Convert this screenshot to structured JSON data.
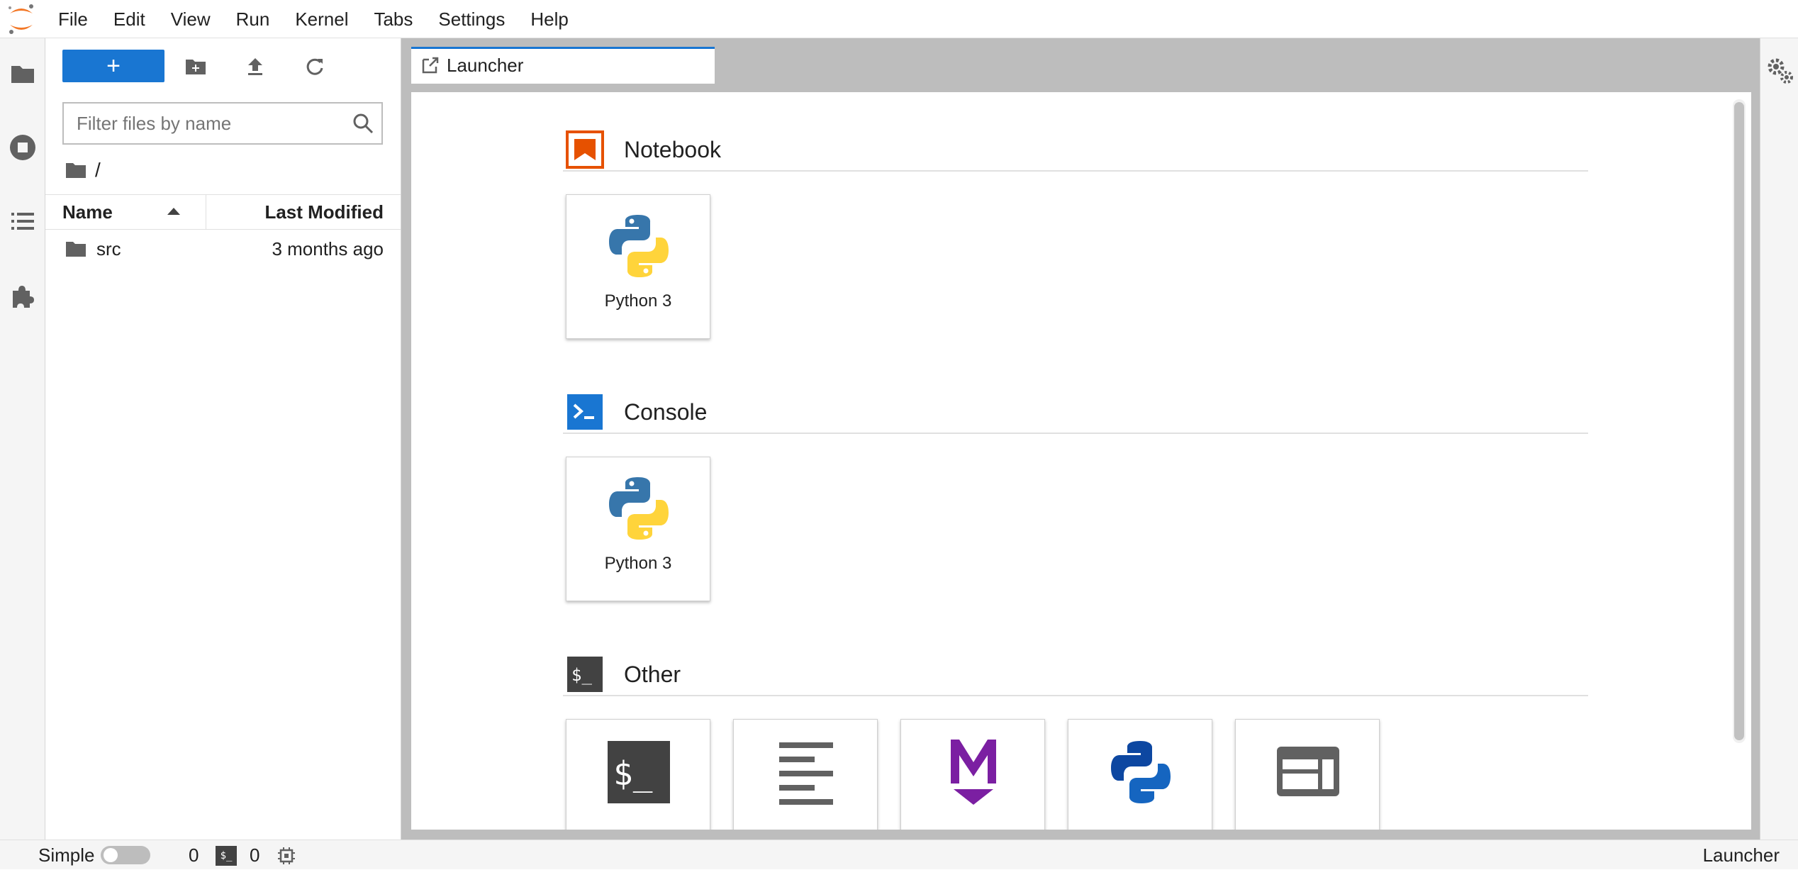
{
  "menubar": {
    "items": [
      "File",
      "Edit",
      "View",
      "Run",
      "Kernel",
      "Tabs",
      "Settings",
      "Help"
    ]
  },
  "activitybar": {
    "icons": [
      "folder-icon",
      "running-icon",
      "toc-icon",
      "extension-icon"
    ]
  },
  "filebrowser": {
    "new_button_label": "+",
    "search_placeholder": "Filter files by name",
    "breadcrumb": "/",
    "columns": {
      "name": "Name",
      "modified": "Last Modified"
    },
    "files": [
      {
        "name": "src",
        "modified": "3 months ago",
        "type": "folder"
      }
    ]
  },
  "tabs": [
    {
      "label": "Launcher",
      "active": true
    }
  ],
  "launcher": {
    "sections": [
      {
        "title": "Notebook",
        "cards": [
          {
            "label": "Python 3"
          }
        ]
      },
      {
        "title": "Console",
        "cards": [
          {
            "label": "Python 3"
          }
        ]
      },
      {
        "title": "Other",
        "cards": [
          {
            "icon": "terminal-icon"
          },
          {
            "icon": "text-file-icon"
          },
          {
            "icon": "markdown-icon"
          },
          {
            "icon": "python-file-icon"
          },
          {
            "icon": "contextual-help-icon"
          }
        ]
      }
    ]
  },
  "statusbar": {
    "simple_label": "Simple",
    "simple_on": false,
    "terminals_count": "0",
    "terminal_icon_text": "$_",
    "kernels_count": "0",
    "right_label": "Launcher"
  },
  "colors": {
    "accent": "#1976d2",
    "notebook": "#e65100",
    "console": "#1976d2",
    "other": "#424242",
    "markdown": "#7b1fa2"
  }
}
